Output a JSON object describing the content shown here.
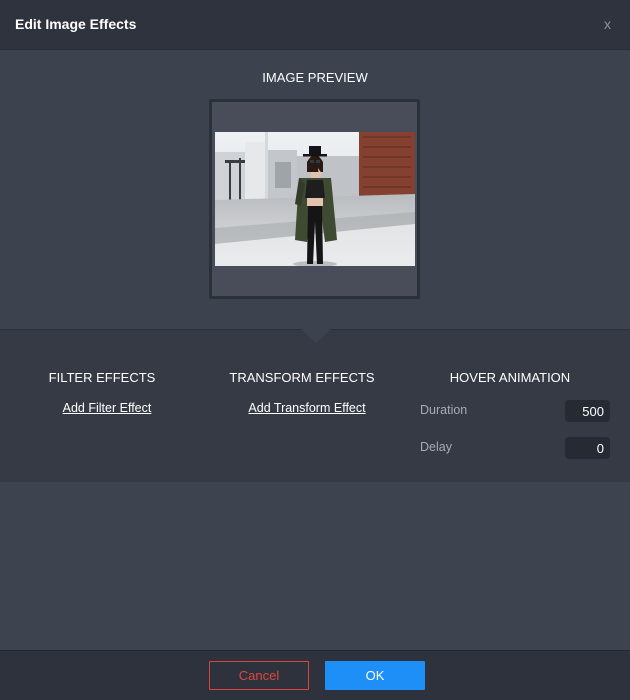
{
  "dialog": {
    "title": "Edit Image Effects",
    "close_label": "x"
  },
  "preview": {
    "label": "IMAGE PREVIEW"
  },
  "filter": {
    "title": "FILTER EFFECTS",
    "add_label": "Add Filter Effect"
  },
  "transform": {
    "title": "TRANSFORM EFFECTS",
    "add_label": "Add Transform Effect"
  },
  "hover": {
    "title": "HOVER ANIMATION",
    "duration_label": "Duration",
    "duration_value": "500",
    "delay_label": "Delay",
    "delay_value": "0"
  },
  "footer": {
    "cancel_label": "Cancel",
    "ok_label": "OK"
  },
  "colors": {
    "accent": "#1d8ff7",
    "cancel": "#e0453c"
  }
}
